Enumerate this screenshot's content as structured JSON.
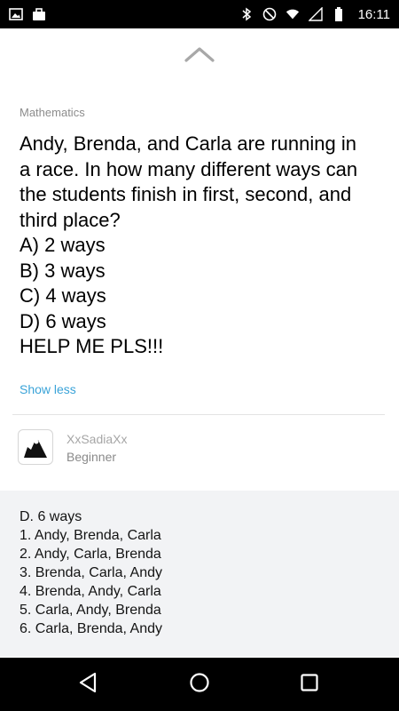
{
  "status_bar": {
    "time": "16:11",
    "icons": [
      "image-icon",
      "briefcase-icon",
      "bluetooth-icon",
      "do-not-disturb-icon",
      "wifi-icon",
      "signal-icon",
      "battery-icon"
    ]
  },
  "question": {
    "subject": "Mathematics",
    "lines": [
      "Andy, Brenda, and Carla are running in",
      "a race. In how many different ways can",
      "the students finish in first, second, and",
      "third place?",
      "A) 2 ways",
      "B) 3 ways",
      "C) 4 ways",
      "D) 6 ways",
      "HELP ME PLS!!!"
    ],
    "show_less_label": "Show less"
  },
  "author": {
    "name": "XxSadiaXx",
    "rank": "Beginner"
  },
  "answer": {
    "lines": [
      "D. 6 ways",
      "1. Andy, Brenda, Carla",
      "2. Andy, Carla, Brenda",
      "3. Brenda, Carla, Andy",
      "4. Brenda, Andy, Carla",
      "5. Carla, Andy, Brenda",
      "6. Carla, Brenda, Andy"
    ]
  },
  "nav_bar": {
    "icons": [
      "back-icon",
      "home-icon",
      "recents-icon"
    ]
  },
  "colors": {
    "accent_link": "#3aa3d8",
    "answer_background": "#f2f3f5",
    "status_bar": "#000000"
  }
}
